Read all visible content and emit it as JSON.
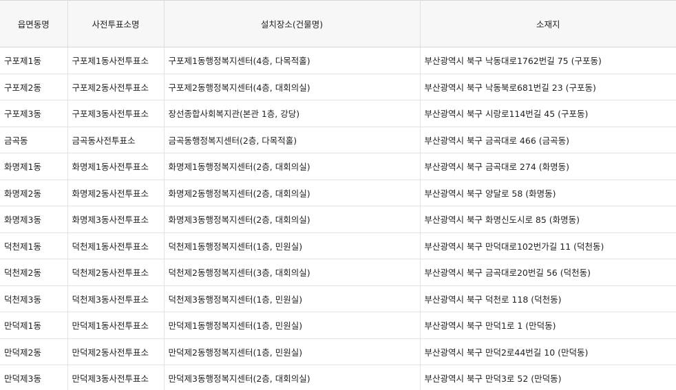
{
  "table": {
    "headers": [
      "읍면동명",
      "사전투표소명",
      "설치장소(건물명)",
      "소재지"
    ],
    "rows": [
      [
        "구포제1동",
        "구포제1동사전투표소",
        "구포제1동행정복지센터(4층, 다목적홀)",
        "부산광역시 북구 낙동대로1762번길 75 (구포동)"
      ],
      [
        "구포제2동",
        "구포제2동사전투표소",
        "구포제2동행정복지센터(4층, 대회의실)",
        "부산광역시 북구 낙동북로681번길 23 (구포동)"
      ],
      [
        "구포제3동",
        "구포제3동사전투표소",
        "장선종합사회복지관(본관 1층, 강당)",
        "부산광역시 북구 시랑로114번길 45 (구포동)"
      ],
      [
        "금곡동",
        "금곡동사전투표소",
        "금곡동행정복지센터(2층, 다목적홀)",
        "부산광역시 북구 금곡대로 466 (금곡동)"
      ],
      [
        "화명제1동",
        "화명제1동사전투표소",
        "화명제1동행정복지센터(2층, 대회의실)",
        "부산광역시 북구 금곡대로 274 (화명동)"
      ],
      [
        "화명제2동",
        "화명제2동사전투표소",
        "화명제2동행정복지센터(2층, 대회의실)",
        "부산광역시 북구 양달로 58 (화명동)"
      ],
      [
        "화명제3동",
        "화명제3동사전투표소",
        "화명제3동행정복지센터(2층, 대회의실)",
        "부산광역시 북구 화명신도시로 85 (화명동)"
      ],
      [
        "덕천제1동",
        "덕천제1동사전투표소",
        "덕천제1동행정복지센터(1층, 민원실)",
        "부산광역시 북구 만덕대로102번가길 11 (덕천동)"
      ],
      [
        "덕천제2동",
        "덕천제2동사전투표소",
        "덕천제2동행정복지센터(3층, 대회의실)",
        "부산광역시 북구 금곡대로20번길 56 (덕천동)"
      ],
      [
        "덕천제3동",
        "덕천제3동사전투표소",
        "덕천제3동행정복지센터(1층, 민원실)",
        "부산광역시 북구 덕천로 118 (덕천동)"
      ],
      [
        "만덕제1동",
        "만덕제1동사전투표소",
        "만덕제1동행정복지센터(1층, 민원실)",
        "부산광역시 북구 만덕1로 1 (만덕동)"
      ],
      [
        "만덕제2동",
        "만덕제2동사전투표소",
        "만덕제2동행정복지센터(1층, 민원실)",
        "부산광역시 북구 만덕2로44번길 10 (만덕동)"
      ],
      [
        "만덕제3동",
        "만덕제3동사전투표소",
        "만덕제3동행정복지센터(2층, 대회의실)",
        "부산광역시 북구 만덕3로 52 (만덕동)"
      ]
    ]
  }
}
